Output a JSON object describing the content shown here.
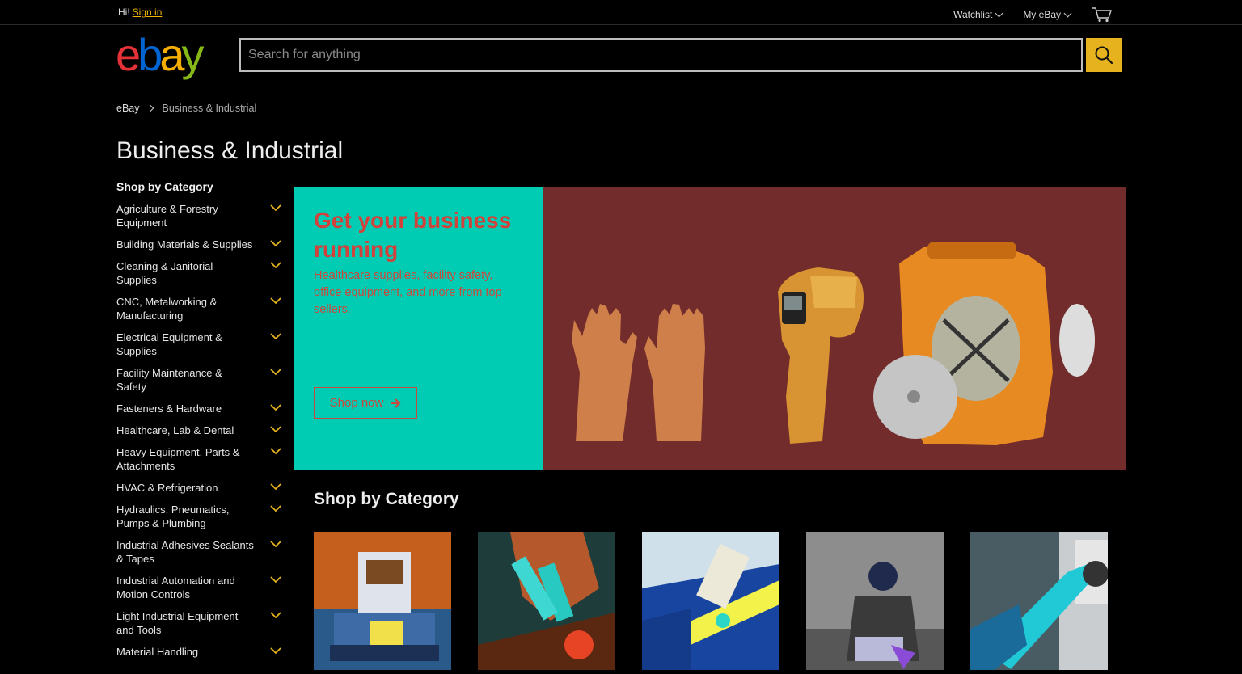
{
  "topbar": {
    "hi": "Hi!",
    "sign_in": "Sign in",
    "watchlist": "Watchlist",
    "my_ebay": "My eBay",
    "cart_icon": "cart-icon"
  },
  "header": {
    "logo_letters": [
      "e",
      "b",
      "a",
      "y"
    ],
    "logo_colors": [
      "#e53238",
      "#0064d2",
      "#f5af02",
      "#86b817"
    ],
    "search_placeholder": "Search for anything",
    "search_icon": "search-icon",
    "accent": "#e6b31e"
  },
  "breadcrumb": {
    "home": "eBay",
    "current": "Business & Industrial"
  },
  "page_title": "Business & Industrial",
  "sidebar": {
    "heading": "Shop by Category",
    "items": [
      "Agriculture & Forestry Equipment",
      "Building Materials & Supplies",
      "Cleaning & Janitorial Supplies",
      "CNC, Metalworking & Manufacturing",
      "Electrical Equipment & Supplies",
      "Facility Maintenance & Safety",
      "Fasteners & Hardware",
      "Healthcare, Lab & Dental",
      "Heavy Equipment, Parts & Attachments",
      "HVAC & Refrigeration",
      "Hydraulics, Pneumatics, Pumps & Plumbing",
      "Industrial Adhesives Sealants & Tapes",
      "Industrial Automation and Motion Controls",
      "Light Industrial Equipment and Tools",
      "Material Handling"
    ]
  },
  "hero": {
    "title": "Get your business running",
    "subtitle": "Healthcare supplies, facility safety, office equipment, and more from top sellers.",
    "button": "Shop now"
  },
  "shop_by_category": {
    "title": "Shop by Category"
  }
}
